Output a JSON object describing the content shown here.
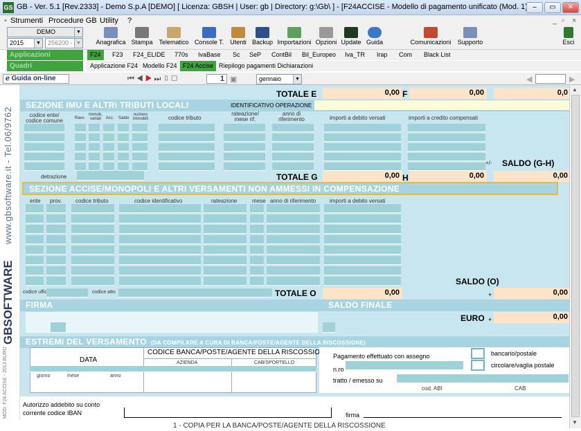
{
  "window": {
    "title": "GB - Ver. 5.1 [Rev.2333] - Demo S.p.A [DEMO]     [ Licenza: GBSH | User: gb | Directory: g:\\Gb\\ ] - [F24ACCISE - Modello di pagamento unificato (Mod. 1)]",
    "logo": "GS",
    "min": "–",
    "max": "▭",
    "close": "✕"
  },
  "menu": [
    "Strumenti",
    "Procedure GB",
    "Utility",
    "?"
  ],
  "toolbar": {
    "company": "DEMO",
    "year": "2015",
    "code": "256200 -",
    "apps": "Applicazioni",
    "quadri": "Quadri",
    "esci": "Esci",
    "buttons": [
      "Anagrafica",
      "Stampa",
      "Telematico",
      "Console T.",
      "Utenti",
      "Backup",
      "Importazioni",
      "Opzioni",
      "Update",
      "Guida"
    ],
    "right_buttons": [
      "Comunicazioni",
      "Supporto"
    ]
  },
  "tabs": [
    "F24",
    "F23",
    "F24_ELIDE",
    "770s",
    "IvaBase",
    "Sc",
    "SeP",
    "ContBil",
    "Bil_Europeo",
    "Iva_TR",
    "Irap",
    "Com",
    "Black List"
  ],
  "subtabs": [
    "Applicazione F24",
    "Modello F24",
    "F24 Accise",
    "Riepilogo pagamenti Dichiarazioni"
  ],
  "nav": {
    "guida": "Guida on-line",
    "page": "1",
    "month": "gennaio"
  },
  "sidebar": {
    "brand": "www.gbsoftware.it - Tel.06/9762",
    "software": "GBSOFTWARE",
    "footer": "MOD. F24 ACCISE - 2013 BURO"
  },
  "sec_top": {
    "totale_e": "TOTALE E",
    "e_val": "0,00",
    "f": "F",
    "f_val": "0,00",
    "right_val": "0,0"
  },
  "imu": {
    "title": "SEZIONE IMU E ALTRI TRIBUTI LOCALI",
    "id_op": "IDENTIFICATIVO OPERAZIONE",
    "cols": [
      "codice ente/ codice comune",
      "Ravv.",
      "Immob. variati",
      "Acc.",
      "Saldo",
      "numero immobili",
      "codice tributo",
      "rateazione/ mese rif.",
      "anno di riferimento",
      "importi a debito versati",
      "importi a credito compensati"
    ],
    "detrazione": "detrazione",
    "totale_g": "TOTALE G",
    "g_val": "0,00",
    "h": "H",
    "h_val": "0,00",
    "saldo": "SALDO  (G-H)",
    "saldo_val": "0,00",
    "pm": "+/-"
  },
  "accise": {
    "title": "SEZIONE ACCISE/MONOPOLI E ALTRI VERSAMENTI NON AMMESSI IN COMPENSAZIONE",
    "cols": [
      "ente",
      "prov.",
      "codice tributo",
      "codice identificativo",
      "rateazione",
      "mese",
      "anno di riferimento",
      "importi a debito versati"
    ],
    "codice_ufficio": "codice ufficio",
    "codice_atto": "codice atto",
    "totale_o": "TOTALE O",
    "o_val": "0,00",
    "saldo": "SALDO  (O)",
    "saldo_val": "0,00",
    "plus": "+"
  },
  "firma": {
    "title": "FIRMA",
    "saldo_finale": "SALDO FINALE",
    "euro": "EURO",
    "euro_val": "0,00",
    "plus": "+"
  },
  "estremi": {
    "title": "ESTREMI DEL VERSAMENTO",
    "note": "(DA COMPILARE A CURA DI BANCA/POSTE/AGENTE DELLA RISCOSSIONE)",
    "data": "DATA",
    "giorno": "giorno",
    "mese": "mese",
    "anno": "anno",
    "codice": "CODICE BANCA/POSTE/AGENTE DELLA RISCOSSIONE",
    "azienda": "AZIENDA",
    "cab": "CAB/SPORTELLO",
    "pagamento": "Pagamento effettuato con assegno",
    "nro": "n.ro",
    "tratto": "tratto / emesso su",
    "bancario": "bancario/postale",
    "circolare": "circolare/vaglia postale",
    "cod_abi": "cod. ABI",
    "cab2": "CAB",
    "autorizzo": "Autorizzo addebito su conto corrente codice IBAN",
    "firma": "firma"
  },
  "bottom": "1 - COPIA PER LA BANCA/POSTE/AGENTE DELLA RISCOSSIONE",
  "colors": {
    "form_bg": "#c8e6ef",
    "header": "#a8d3e0",
    "input": "#9ed1d8",
    "totals": "#fde3c8",
    "accent": "#e9b93a"
  }
}
